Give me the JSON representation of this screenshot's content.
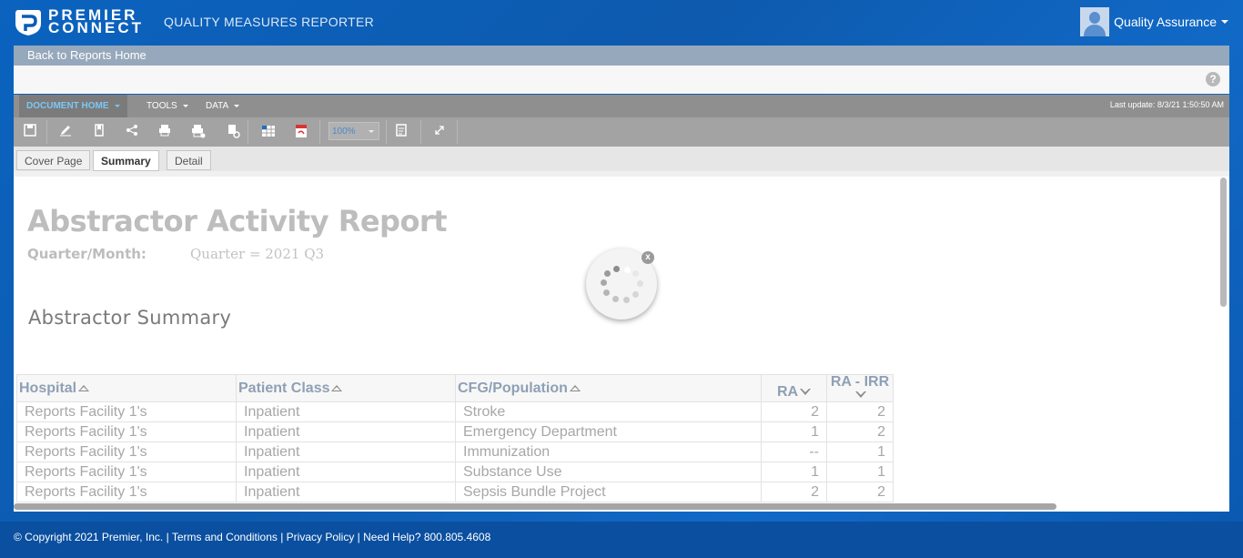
{
  "header": {
    "logo_line1": "PREMIER",
    "logo_line2": "CONNECT",
    "app_title": "QUALITY MEASURES REPORTER",
    "user_name": "Quality Assurance"
  },
  "back_link": "Back to Reports Home",
  "menubar": {
    "items": [
      {
        "label": "DOCUMENT HOME"
      },
      {
        "label": "TOOLS"
      },
      {
        "label": "DATA"
      }
    ],
    "last_update": "Last update: 8/3/21 1:50:50 AM"
  },
  "toolbar": {
    "icons": [
      "save-icon",
      "edit-icon",
      "bookmark-icon",
      "share-icon",
      "print-icon",
      "print-setup-icon",
      "refresh-icon",
      "export-excel-icon",
      "export-pdf-icon",
      "filter-icon",
      "fullscreen-icon"
    ],
    "zoom": "100%"
  },
  "tabs": [
    {
      "label": "Cover Page"
    },
    {
      "label": "Summary"
    },
    {
      "label": "Detail"
    }
  ],
  "report": {
    "title": "Abstractor Activity Report",
    "filter_label": "Quarter/Month:",
    "filter_value": "Quarter = 2021 Q3",
    "section_title": "Abstractor Summary"
  },
  "table": {
    "columns": [
      "Hospital",
      "Patient Class",
      "CFG/Population",
      "RA",
      "RA - IRR"
    ],
    "rows": [
      [
        "Reports Facility 1's",
        "Inpatient",
        "Stroke",
        "2",
        "2"
      ],
      [
        "Reports Facility 1's",
        "Inpatient",
        "Emergency Department",
        "1",
        "2"
      ],
      [
        "Reports Facility 1's",
        "Inpatient",
        "Immunization",
        "--",
        "1"
      ],
      [
        "Reports Facility 1's",
        "Inpatient",
        "Substance Use",
        "1",
        "1"
      ],
      [
        "Reports Facility 1's",
        "Inpatient",
        "Sepsis Bundle Project",
        "2",
        "2"
      ]
    ]
  },
  "spinner_close": "x",
  "footer": "© Copyright 2021 Premier, Inc. | Terms and Conditions | Privacy Policy | Need Help? 800.805.4608",
  "colors": {
    "brand_blue": "#0a5cb4",
    "menu_active": "#7cc7f5"
  }
}
